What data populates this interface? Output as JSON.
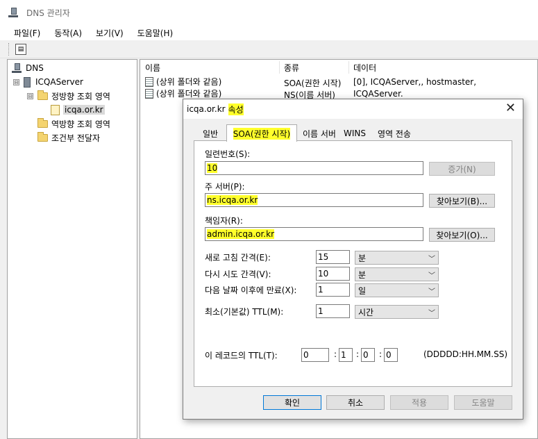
{
  "window": {
    "title": "DNS 관리자",
    "icon": "dns-manager-icon"
  },
  "menu": [
    "파일(F)",
    "동작(A)",
    "보기(V)",
    "도움말(H)"
  ],
  "toolbar": {
    "icon": "properties-icon"
  },
  "tree": {
    "root": "DNS",
    "server": "ICQAServer",
    "forward_zones": "정방향 조회 영역",
    "zone": "icqa.or.kr",
    "reverse_zones": "역방향 조회 영역",
    "conditional": "조건부 전달자",
    "expanded_symbol": "⊟"
  },
  "list": {
    "columns": [
      "이름",
      "종류",
      "데이터"
    ],
    "rows": [
      {
        "name": "(상위 폴더와 같음)",
        "type": "SOA(권한 시작)",
        "data": "[0], ICQAServer,, hostmaster,"
      },
      {
        "name": "(상위 폴더와 같음)",
        "type": "NS(이름 서버)",
        "data": "ICQAServer."
      }
    ]
  },
  "dialog": {
    "title_zone": "icqa.or.kr",
    "title_suffix": "속성",
    "close": "✕",
    "tabs": [
      "일반",
      "SOA(권한 시작)",
      "이름 서버",
      "WINS",
      "영역 전송"
    ],
    "serial_label": "일련번호(S):",
    "serial_value": "10",
    "increment_button": "증가(N)",
    "primary_label": "주 서버(P):",
    "primary_value": "ns.icqa.or.kr",
    "browse_b": "찾아보기(B)...",
    "responsible_label": "책임자(R):",
    "responsible_value": "admin.icqa.or.kr",
    "browse_o": "찾아보기(O)...",
    "refresh_label": "새로 고침 간격(E):",
    "refresh_value": "15",
    "refresh_unit": "분",
    "retry_label": "다시 시도 간격(V):",
    "retry_value": "10",
    "retry_unit": "분",
    "expire_label": "다음 날짜 이후에 만료(X):",
    "expire_value": "1",
    "expire_unit": "일",
    "minttl_label": "최소(기본값) TTL(M):",
    "minttl_value": "1",
    "minttl_unit": "시간",
    "record_ttl_label": "이 레코드의 TTL(T):",
    "ttl_d": "0",
    "ttl_h": "1",
    "ttl_m": "0",
    "ttl_s": "0",
    "ttl_sep": ":",
    "ttl_format": "(DDDDD:HH.MM.SS)",
    "ok": "확인",
    "cancel": "취소",
    "apply": "적용",
    "help": "도움말"
  },
  "colors": {
    "highlight": "#ffff2b",
    "selection": "#d9d9d9",
    "default_button_border": "#0078d7"
  }
}
